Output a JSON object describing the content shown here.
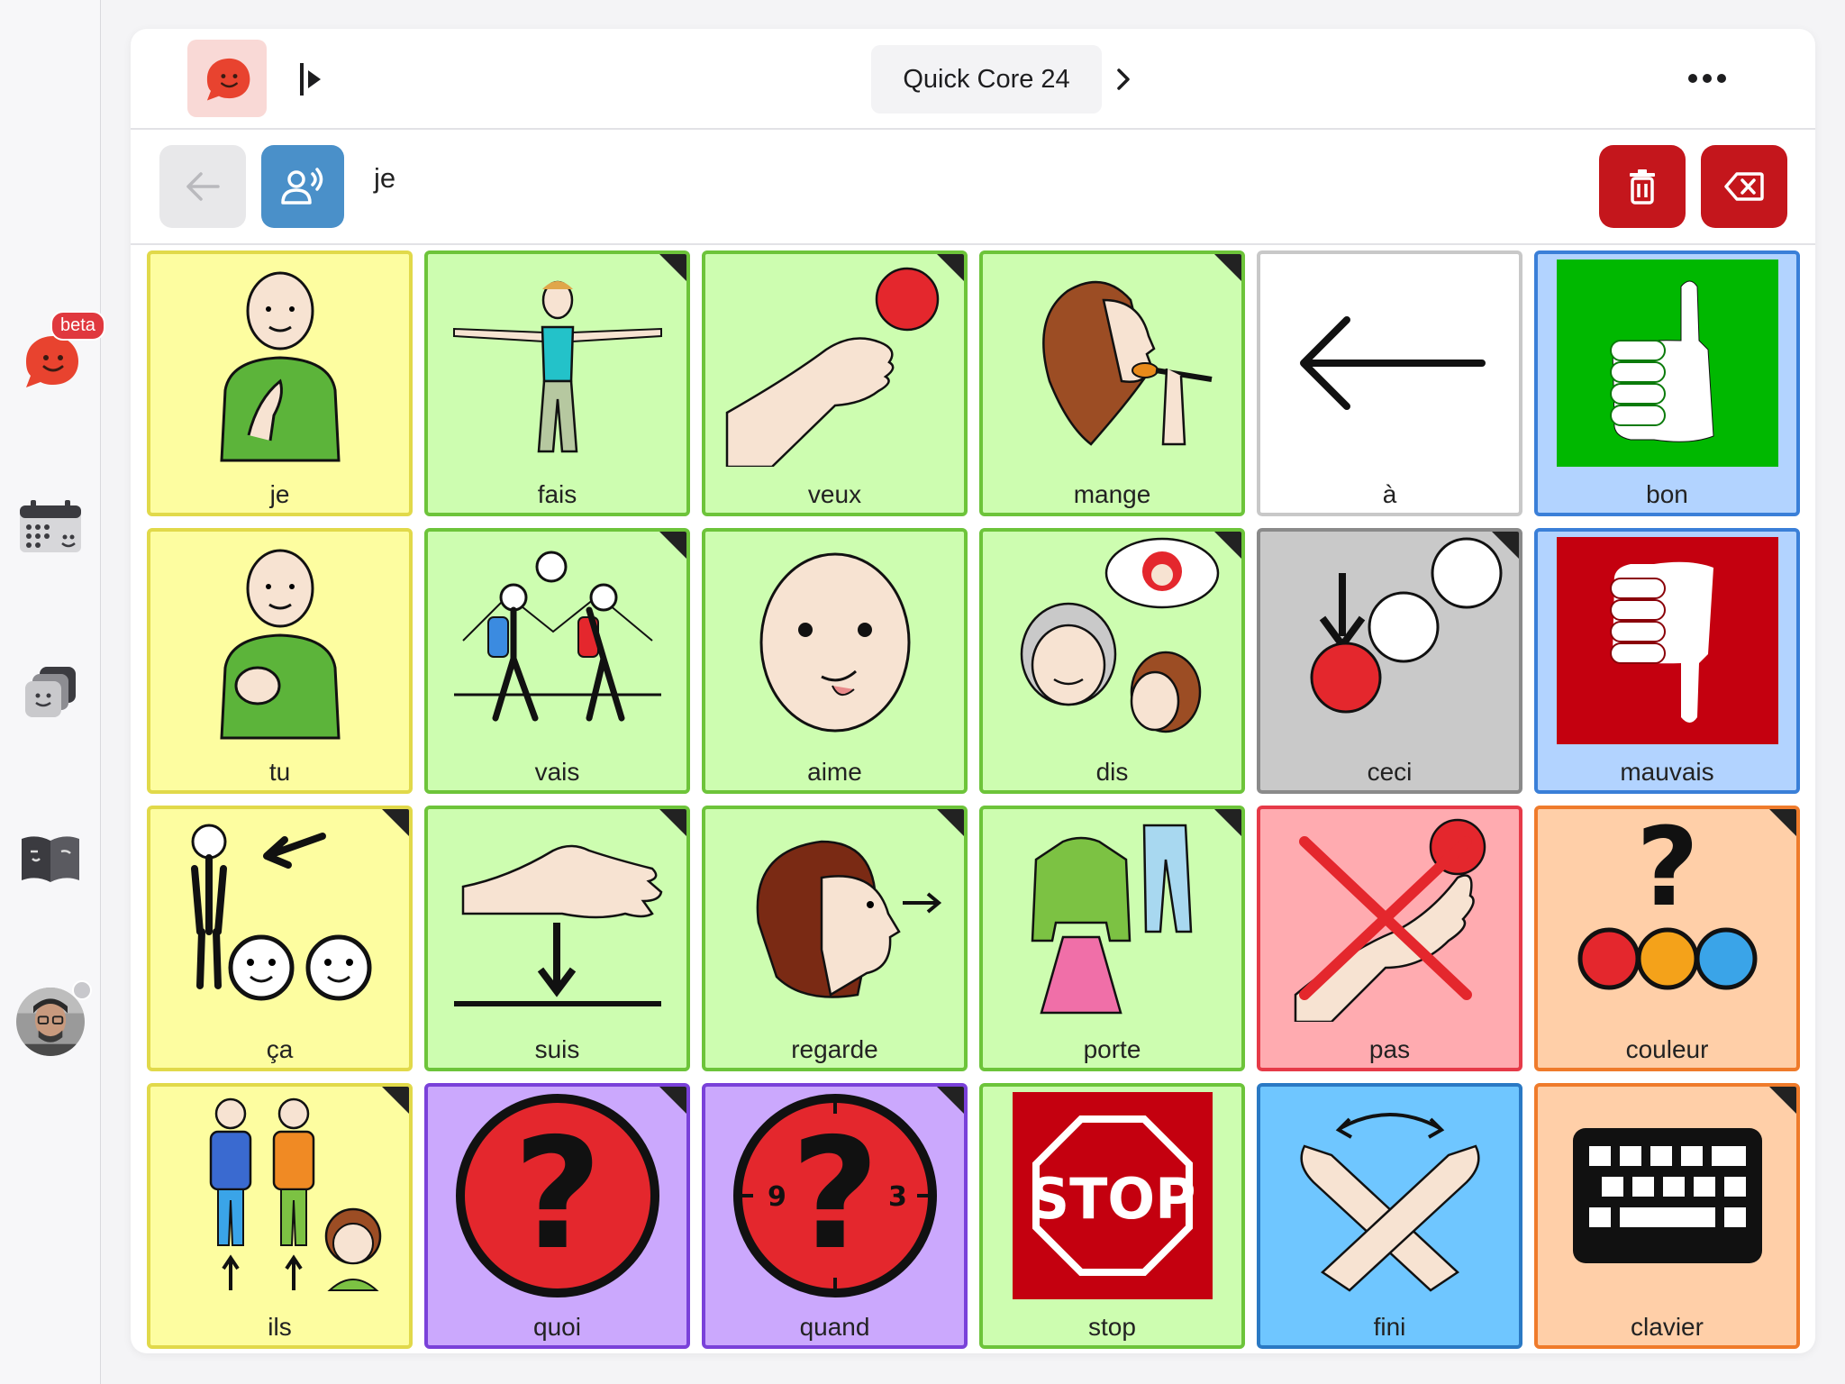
{
  "rail": {
    "beta_label": "beta",
    "items": [
      {
        "icon": "talker-icon"
      },
      {
        "icon": "calendar-icon"
      },
      {
        "icon": "boards-icon"
      },
      {
        "icon": "book-icon"
      },
      {
        "icon": "avatar"
      }
    ]
  },
  "header": {
    "board_title": "Quick Core 24"
  },
  "message": {
    "text": "je"
  },
  "tiles": [
    {
      "label": "je",
      "color": "yellow",
      "folder": false
    },
    {
      "label": "fais",
      "color": "green",
      "folder": true
    },
    {
      "label": "veux",
      "color": "green",
      "folder": true
    },
    {
      "label": "mange",
      "color": "green",
      "folder": true
    },
    {
      "label": "à",
      "color": "white",
      "folder": false
    },
    {
      "label": "bon",
      "color": "blue",
      "folder": false
    },
    {
      "label": "tu",
      "color": "yellow",
      "folder": false
    },
    {
      "label": "vais",
      "color": "green",
      "folder": true
    },
    {
      "label": "aime",
      "color": "green",
      "folder": false
    },
    {
      "label": "dis",
      "color": "green",
      "folder": true
    },
    {
      "label": "ceci",
      "color": "gray",
      "folder": true
    },
    {
      "label": "mauvais",
      "color": "blue",
      "folder": false
    },
    {
      "label": "ça",
      "color": "yellow",
      "folder": true
    },
    {
      "label": "suis",
      "color": "green",
      "folder": true
    },
    {
      "label": "regarde",
      "color": "green",
      "folder": true
    },
    {
      "label": "porte",
      "color": "green",
      "folder": true
    },
    {
      "label": "pas",
      "color": "red",
      "folder": false
    },
    {
      "label": "couleur",
      "color": "orange",
      "folder": true
    },
    {
      "label": "ils",
      "color": "yellow",
      "folder": true
    },
    {
      "label": "quoi",
      "color": "purple",
      "folder": true
    },
    {
      "label": "quand",
      "color": "purple",
      "folder": true
    },
    {
      "label": "stop",
      "color": "green",
      "folder": false
    },
    {
      "label": "fini",
      "color": "sky",
      "folder": false
    },
    {
      "label": "clavier",
      "color": "orange",
      "folder": true
    }
  ]
}
